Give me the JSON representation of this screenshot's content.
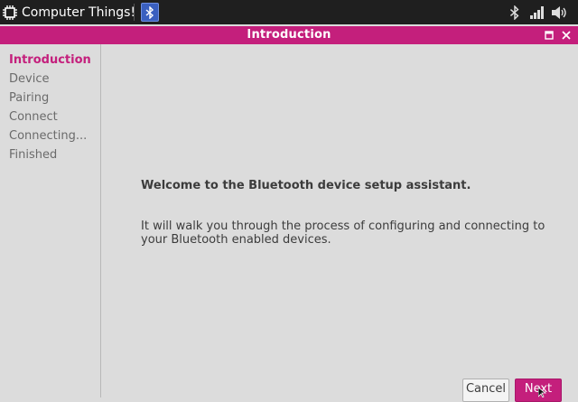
{
  "panel": {
    "app_title": "Computer Things!"
  },
  "window": {
    "title": "Introduction"
  },
  "sidebar": {
    "steps": [
      {
        "label": "Introduction"
      },
      {
        "label": "Device"
      },
      {
        "label": "Pairing"
      },
      {
        "label": "Connect"
      },
      {
        "label": "Connecting..."
      },
      {
        "label": "Finished"
      }
    ],
    "active_step": "Introduction"
  },
  "main": {
    "welcome": "Welcome to the Bluetooth device setup assistant.",
    "description": "It will walk you through the process of configuring and connecting to your Bluetooth enabled devices."
  },
  "buttons": {
    "cancel": "Cancel",
    "next": "Next"
  },
  "colors": {
    "accent": "#c41f7c",
    "panel_bg": "#1f1f1f",
    "window_bg": "#dcdcdc"
  }
}
